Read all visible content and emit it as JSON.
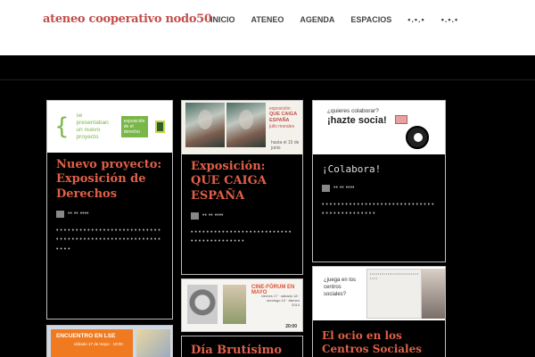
{
  "site": {
    "logo": "ateneo cooperativo nodo50"
  },
  "nav": [
    "INICIO",
    "ATENEO",
    "AGENDA",
    "ESPACIOS",
    "•.•.•",
    "•.•.•"
  ],
  "cards": {
    "c1": {
      "img": {
        "brace": "{",
        "text": "se presentaban un nuevo proyecto",
        "box": "exposición de el derecho",
        "brace_close": "}"
      },
      "title": "Nuevo proyecto: Exposición de Derechos",
      "date": "•• •• ••••",
      "excerpt": "• • • • • • • • • • • • • • • • • • • • • • • • • • • • • • • • • • • • • • • • • • • • • • • • • • • • • • • • • •"
    },
    "c2": {
      "img": {
        "small": "exposición",
        "headline": "QUE CAIGA ESPAÑA",
        "sub": "julio morales",
        "until": "hasta el 15 de junio"
      },
      "title": "Exposición: QUE CAIGA ESPAÑA",
      "date": "•• •• ••••",
      "excerpt": "• • • • • • • • • • • • • • • • • • • • • • • • • • • • • • • • • • • • • • • •"
    },
    "c3": {
      "img": {
        "question": "¿quieres colaborar?",
        "cta": "¡hazte socia!"
      },
      "title": "¡Colabora!",
      "date": "•• •• ••••",
      "excerpt": "• • • • • • • • • • • • • • • • • • • • • • • • • • • • • • • • • • • • • • • • • • •"
    },
    "c4": {
      "img": {
        "heading": "CINE-FÓRUM EN MAYO",
        "info": "viernes 17 · sábado 18 · domingo 19 · Ateneo 2014",
        "time": "20:00"
      }
    },
    "c5": {
      "img": {
        "question": "¿juega en los centros sociales?",
        "paper": "• • • • • • • • • • • • • • • • • • • • • • • • • • • • •"
      },
      "title": "El ocio en los Centros Sociales"
    },
    "c6": {
      "img": {
        "heading": "ENCUENTRO EN LSE",
        "sub": "sábado 17 de mayo · 18:00"
      }
    },
    "c7": {
      "title": "Día Brutísimo"
    }
  }
}
